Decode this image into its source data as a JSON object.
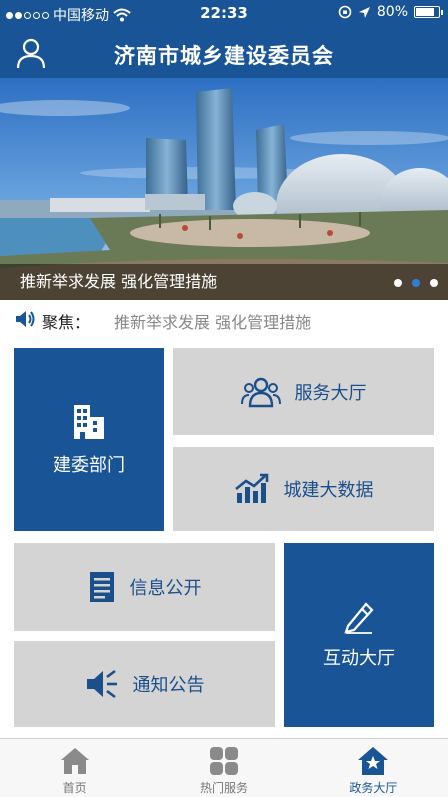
{
  "status_bar": {
    "carrier": "中国移动",
    "time": "22:33",
    "battery": "80%"
  },
  "header": {
    "title": "济南市城乡建设委员会",
    "user_icon": "user-icon"
  },
  "banner": {
    "caption": "推新举求发展 强化管理措施",
    "slide_count": 3,
    "active_slide": 2
  },
  "focus": {
    "label": "聚焦：",
    "headline": "推新举求发展 强化管理措施",
    "icon": "speaker-icon"
  },
  "tiles": {
    "construction_dept": {
      "label": "建委部门",
      "icon": "building-icon"
    },
    "service_hall": {
      "label": "服务大厅",
      "icon": "people-icon"
    },
    "big_data": {
      "label": "城建大数据",
      "icon": "chart-icon"
    },
    "info_public": {
      "label": "信息公开",
      "icon": "document-icon"
    },
    "notice": {
      "label": "通知公告",
      "icon": "megaphone-icon"
    },
    "interaction_hall": {
      "label": "互动大厅",
      "icon": "pen-icon"
    }
  },
  "tabbar": {
    "items": [
      {
        "label": "首页",
        "icon": "home-icon",
        "active": false
      },
      {
        "label": "热门服务",
        "icon": "grid-icon",
        "active": false
      },
      {
        "label": "政务大厅",
        "icon": "hall-icon",
        "active": true
      }
    ]
  },
  "colors": {
    "brand_blue": "#195596",
    "tile_gray": "#d4d4d4"
  }
}
